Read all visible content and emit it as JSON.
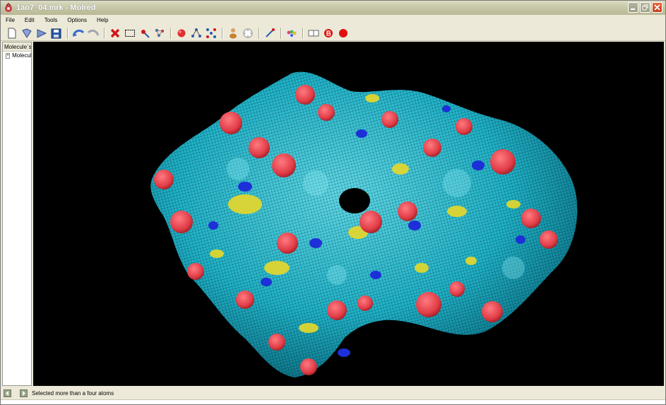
{
  "window": {
    "title": "1ao7_04.mrk - Molred"
  },
  "menu": [
    "File",
    "Edit",
    "Tools",
    "Options",
    "Help"
  ],
  "toolbar": {
    "tools": [
      {
        "name": "new-document-icon",
        "color": "#ffffff"
      },
      {
        "name": "open-file-icon",
        "color": "#6a86c8"
      },
      {
        "name": "open-folder-icon",
        "color": "#6a86c8"
      },
      {
        "name": "save-icon",
        "color": "#2a5aa8"
      },
      {
        "name": "undo-icon",
        "color": "#3a6ad0"
      },
      {
        "name": "redo-icon",
        "color": "#9aa0a8"
      },
      {
        "name": "delete-icon",
        "color": "#d01818"
      },
      {
        "name": "rectangle-select-icon",
        "color": "#000000"
      },
      {
        "name": "pointer-select-icon",
        "color": "#d01818"
      },
      {
        "name": "multi-select-icon",
        "color": "#2a5aa8"
      },
      {
        "name": "atom-icon",
        "color": "#e03030"
      },
      {
        "name": "bond-icon",
        "color": "#2a5aa8"
      },
      {
        "name": "molecule-icon",
        "color": "#2a5aa8"
      },
      {
        "name": "person-icon",
        "color": "#c88030"
      },
      {
        "name": "rotate-icon",
        "color": "#888888"
      },
      {
        "name": "wand-icon",
        "color": "#2a5aa8"
      },
      {
        "name": "color-palette-icon",
        "color": "#d060c0"
      },
      {
        "name": "window-split-icon",
        "color": "#666666"
      },
      {
        "name": "record-b-icon",
        "color": "#e01010"
      },
      {
        "name": "record-icon",
        "color": "#e01010"
      }
    ]
  },
  "panel": {
    "header": "Molecule`s s",
    "tree_item": "Molecule"
  },
  "status": {
    "message": "Selected more than a four atoms"
  },
  "colors": {
    "surface": "#1fb2c8",
    "oxygen": "#e03c46",
    "nitrogen": "#1c2fd8",
    "sulfur": "#e8d82a",
    "background": "#000000"
  }
}
